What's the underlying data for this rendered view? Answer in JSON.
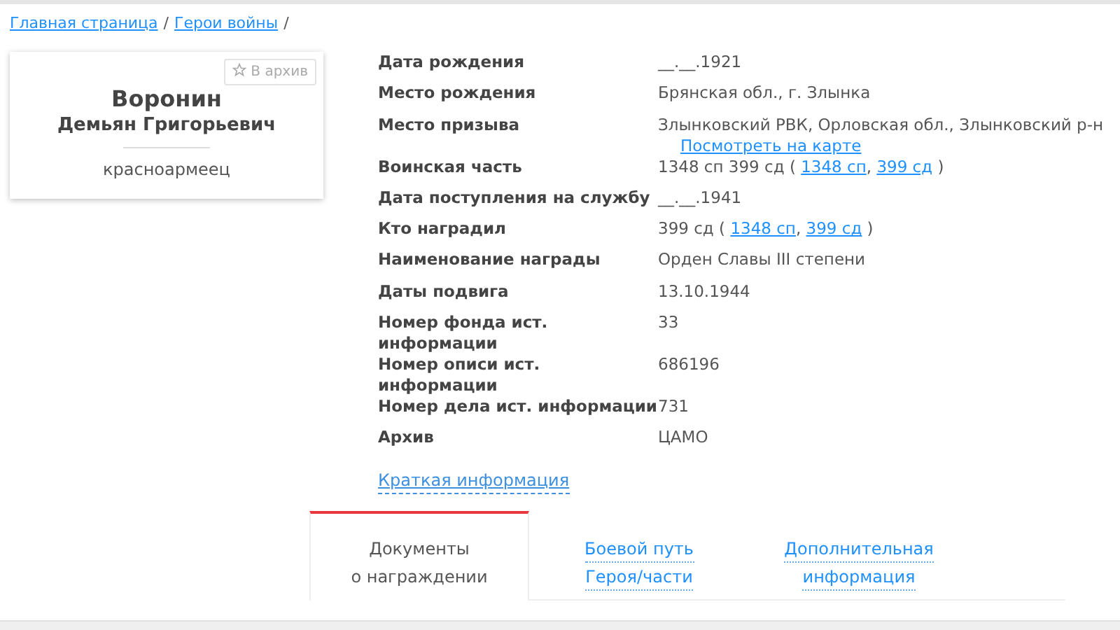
{
  "breadcrumb": [
    {
      "label": "Главная страница"
    },
    {
      "label": "Герои войны"
    }
  ],
  "breadcrumb_separator": "/",
  "card": {
    "archive_button": "В архив",
    "surname": "Воронин",
    "given_names": "Демьян Григорьевич",
    "rank": "красноармеец"
  },
  "details": [
    {
      "label": "Дата рождения",
      "value": [
        {
          "text": "__.__.1921"
        }
      ]
    },
    {
      "label": "Место рождения",
      "value": [
        {
          "text": "Брянская обл., г. Злынка"
        }
      ]
    },
    {
      "label": "Место призыва",
      "value": [
        {
          "text": "Злынковский РВК, Орловская обл., Злынковский р-н"
        }
      ],
      "map_link": "Посмотреть на карте"
    },
    {
      "label": "Воинская часть",
      "value": [
        {
          "text": "1348 сп 399 сд ( "
        },
        {
          "link": "1348 сп"
        },
        {
          "text": ", "
        },
        {
          "link": "399 сд"
        },
        {
          "text": " )"
        }
      ]
    },
    {
      "label": "Дата поступления на службу",
      "value": [
        {
          "text": "__.__.1941"
        }
      ]
    },
    {
      "label": "Кто наградил",
      "value": [
        {
          "text": "399 сд ( "
        },
        {
          "link": "1348 сп"
        },
        {
          "text": ", "
        },
        {
          "link": "399 сд"
        },
        {
          "text": " )"
        }
      ]
    },
    {
      "label": "Наименование награды",
      "value": [
        {
          "text": "Орден Славы III степени"
        }
      ]
    },
    {
      "label": "Даты подвига",
      "value": [
        {
          "text": "13.10.1944"
        }
      ]
    },
    {
      "label": "Номер фонда ист. информации",
      "value": [
        {
          "text": "33"
        }
      ]
    },
    {
      "label": "Номер описи ист. информации",
      "value": [
        {
          "text": "686196"
        }
      ]
    },
    {
      "label": "Номер дела ист. информации",
      "value": [
        {
          "text": "731"
        }
      ]
    },
    {
      "label": "Архив",
      "value": [
        {
          "text": "ЦАМО"
        }
      ]
    }
  ],
  "short_info_link": "Краткая информация",
  "tabs": [
    {
      "lines": [
        "Документы",
        "о награждении"
      ],
      "selected": true
    },
    {
      "lines": [
        "Боевой путь",
        "Героя/части"
      ],
      "selected": false
    },
    {
      "lines": [
        "Дополнительная",
        "информация"
      ],
      "selected": false
    }
  ]
}
